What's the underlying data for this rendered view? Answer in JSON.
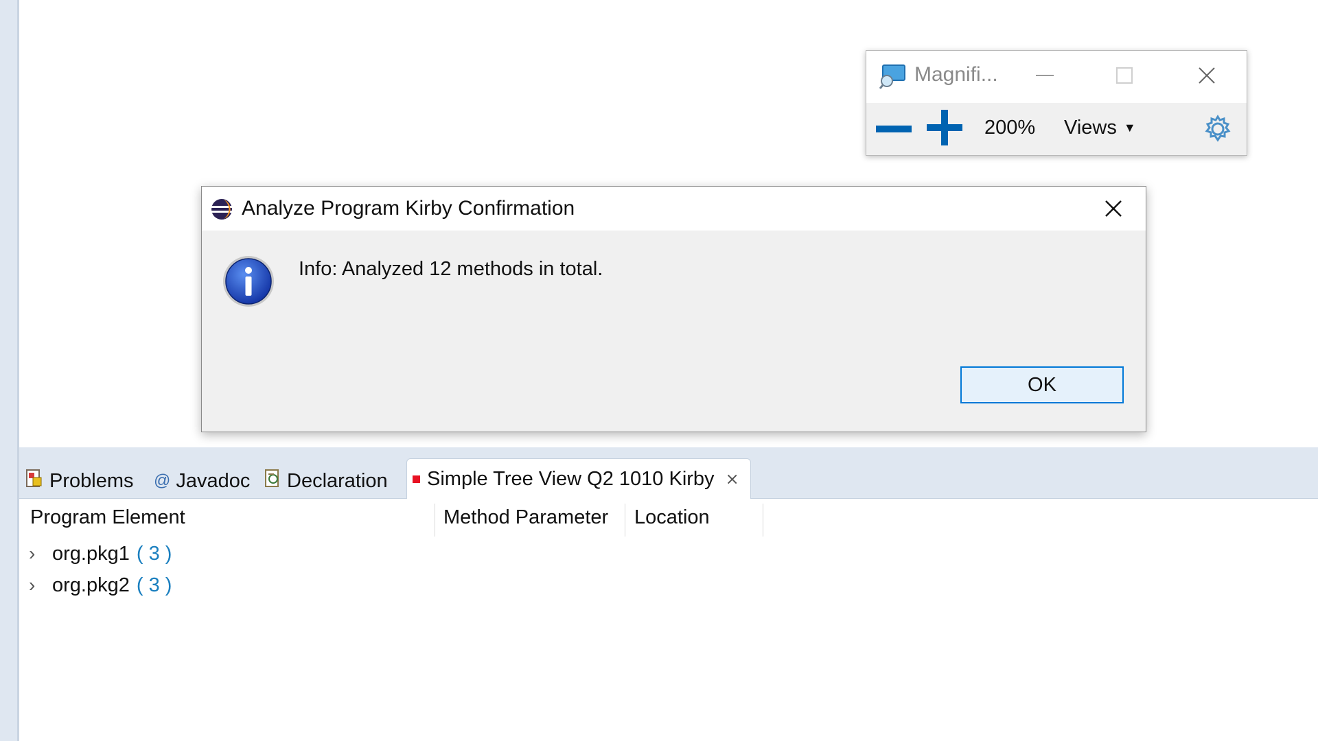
{
  "magnifier": {
    "title": "Magnifi...",
    "zoom_level": "200%",
    "views_label": "Views"
  },
  "dialog": {
    "title": "Analyze Program Kirby Confirmation",
    "message": "Info: Analyzed 12 methods in total.",
    "ok_label": "OK"
  },
  "views_panel": {
    "tabs": [
      {
        "label": "Problems",
        "icon": "problems-icon"
      },
      {
        "label": "Javadoc",
        "icon": "at-icon"
      },
      {
        "label": "Declaration",
        "icon": "declaration-icon"
      },
      {
        "label": "Simple Tree View Q2 1010 Kirby",
        "icon": "red-marker",
        "active": true
      }
    ],
    "columns": [
      "Program Element",
      "Method Parameter",
      "Location"
    ],
    "rows": [
      {
        "label": "org.pkg1",
        "count": "( 3 )"
      },
      {
        "label": "org.pkg2",
        "count": "( 3 )"
      }
    ]
  },
  "colors": {
    "accent": "#0078d7",
    "count_blue": "#1a7fbf",
    "active_marker": "#e81123",
    "workbench_band": "#dfe7f1"
  }
}
